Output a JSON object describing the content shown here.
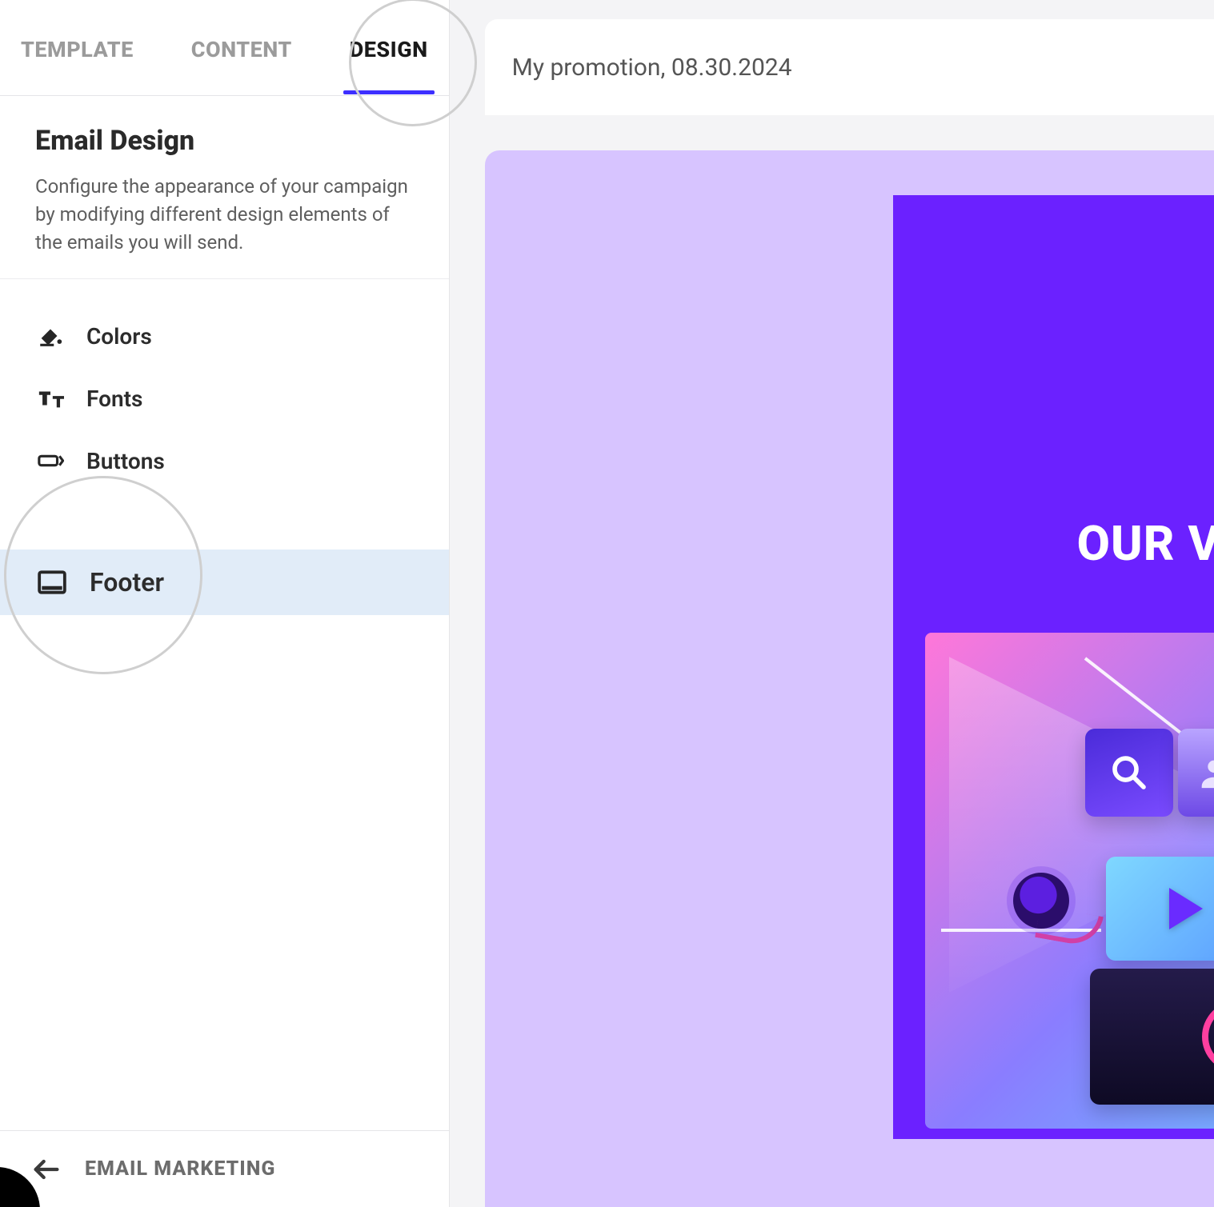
{
  "tabs": {
    "template": "TEMPLATE",
    "content": "CONTENT",
    "design": "DESIGN"
  },
  "section": {
    "title": "Email Design",
    "description": "Configure the appearance of your campaign by modifying different design elements of the emails you will send."
  },
  "design_items": {
    "colors": "Colors",
    "fonts": "Fonts",
    "buttons": "Buttons",
    "footer": "Footer"
  },
  "back": {
    "label": "EMAIL MARKETING"
  },
  "preview": {
    "subject": "My promotion, 08.30.2024",
    "hero_title": "OUR V"
  }
}
